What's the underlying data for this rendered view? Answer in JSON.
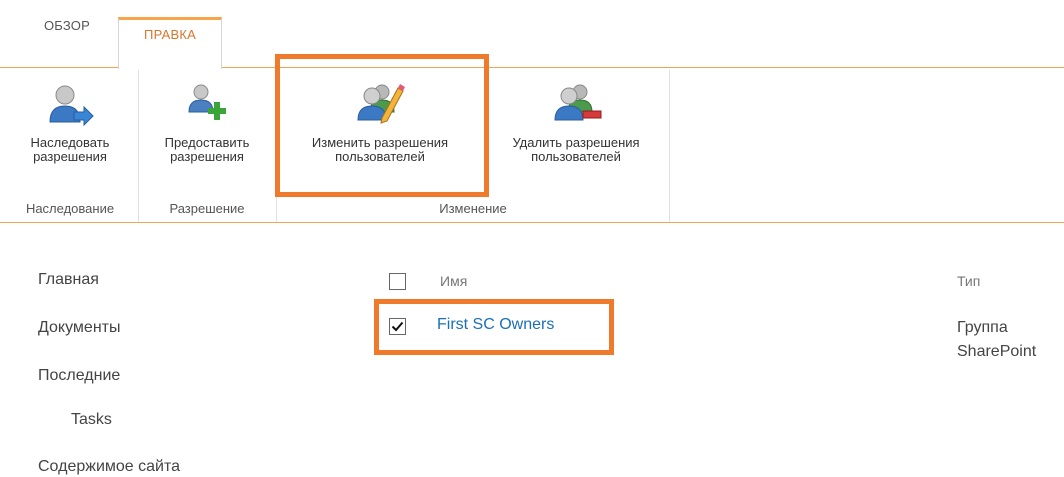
{
  "tabs": [
    {
      "label": "ОБЗОР"
    },
    {
      "label": "ПРАВКА"
    }
  ],
  "ribbon": {
    "buttons": [
      {
        "label": "Наследовать\nразрешения",
        "icon": "users-inherit-icon"
      },
      {
        "label": "Предоставить\nразрешения",
        "icon": "user-add-icon"
      },
      {
        "label": "Изменить разрешения\nпользователей",
        "icon": "users-edit-icon"
      },
      {
        "label": "Удалить разрешения\nпользователей",
        "icon": "users-remove-icon"
      }
    ],
    "groups": [
      {
        "label": "Наследование"
      },
      {
        "label": "Разрешение"
      },
      {
        "label": "Изменение"
      }
    ]
  },
  "nav": {
    "items": [
      {
        "label": "Главная"
      },
      {
        "label": "Документы"
      },
      {
        "label": "Последние"
      },
      {
        "label": "Tasks"
      },
      {
        "label": "Содержимое сайта"
      }
    ]
  },
  "list": {
    "columns": {
      "name": "Имя",
      "type": "Тип"
    },
    "rows": [
      {
        "name": "First SC Owners",
        "type": "Группа\nSharePoint",
        "checked": true
      }
    ]
  },
  "colors": {
    "accent": "#f07a2c",
    "tab_active": "#d8762e",
    "link": "#1b6fb8"
  }
}
